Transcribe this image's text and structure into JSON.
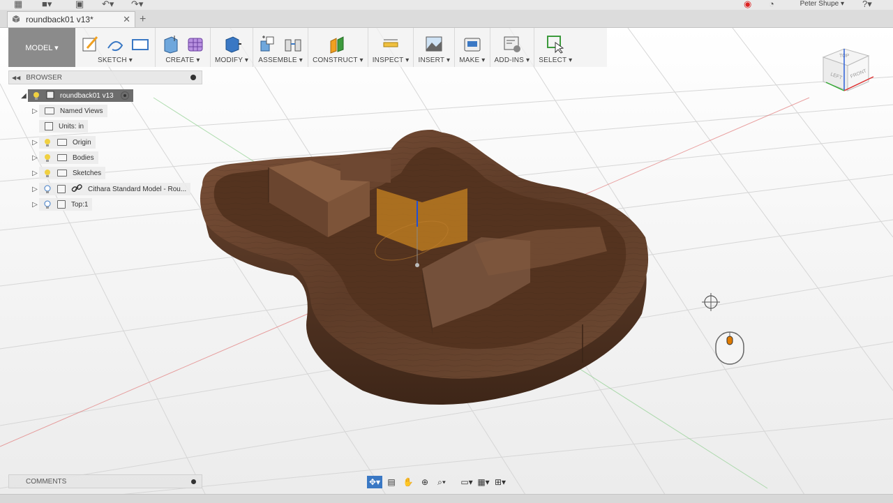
{
  "app": {
    "user_name": "Peter Shupe ▾"
  },
  "document_tab": {
    "title": "roundback01 v13*",
    "close_label": "✕",
    "add_label": "+"
  },
  "toolbar": {
    "workspace_label": "MODEL ▾",
    "groups": [
      {
        "label": "SKETCH ▾"
      },
      {
        "label": "CREATE ▾"
      },
      {
        "label": "MODIFY ▾"
      },
      {
        "label": "ASSEMBLE ▾"
      },
      {
        "label": "CONSTRUCT ▾"
      },
      {
        "label": "INSPECT ▾"
      },
      {
        "label": "INSERT ▾"
      },
      {
        "label": "MAKE ▾"
      },
      {
        "label": "ADD-INS ▾"
      },
      {
        "label": "SELECT ▾"
      }
    ]
  },
  "browser": {
    "title": "BROWSER",
    "root": "roundback01 v13",
    "items": [
      {
        "label": "Named Views"
      },
      {
        "label": "Units: in"
      },
      {
        "label": "Origin"
      },
      {
        "label": "Bodies"
      },
      {
        "label": "Sketches"
      },
      {
        "label": "Cithara Standard Model - Rou..."
      },
      {
        "label": "Top:1"
      }
    ]
  },
  "viewcube": {
    "top": "TOP",
    "left": "LEFT",
    "front": "FRONT"
  },
  "comments": {
    "title": "COMMENTS"
  },
  "colors": {
    "wood_dark": "#4a3020",
    "wood_mid": "#6b4630",
    "wood_light": "#8a5f42",
    "model_button": "#8b8b8b",
    "nav_active": "#3a78c4",
    "selection_orange": "#f0a020"
  }
}
